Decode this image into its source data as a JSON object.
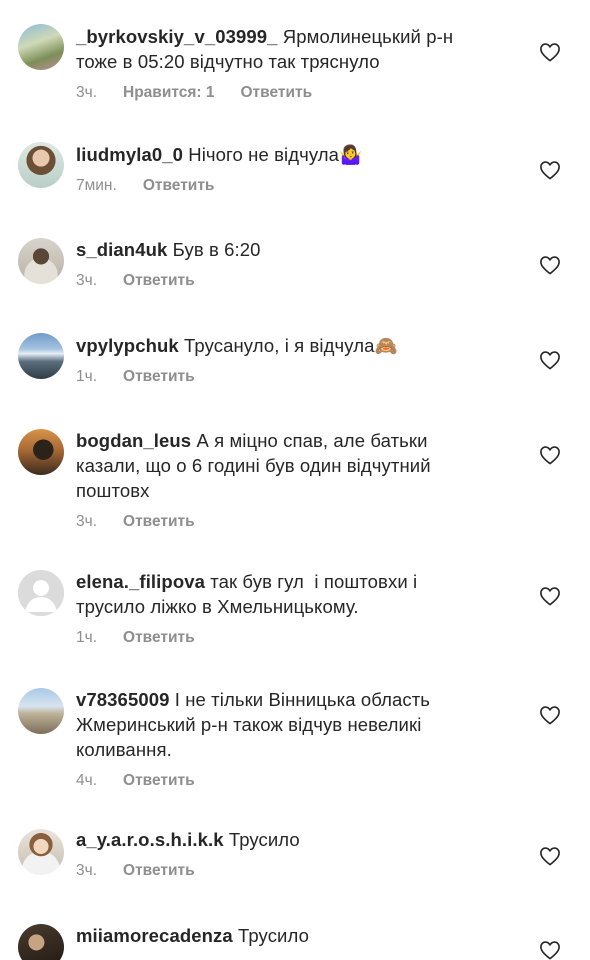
{
  "comments": [
    {
      "avatar": "avatar-photo-outdoor",
      "username": "_byrkovskiy_v_03999_",
      "text_lines": [
        " Ярмолинецький р-н",
        "тоже в 05:20 відчутно так тряснуло"
      ],
      "time": "3ч.",
      "likes": "Нравится: 1",
      "reply": "Ответить"
    },
    {
      "avatar": "avatar-photo-woman",
      "username": "liudmyla0_0",
      "text_lines": [
        " Нічого не відчула🤷‍♀️"
      ],
      "time": "7мин.",
      "likes": "",
      "reply": "Ответить"
    },
    {
      "avatar": "avatar-photo-person",
      "username": "s_dian4uk",
      "text_lines": [
        " Був в 6:20"
      ],
      "time": "3ч.",
      "likes": "",
      "reply": "Ответить"
    },
    {
      "avatar": "avatar-photo-mountains",
      "username": "vpylypchuk",
      "text_lines": [
        " Трусануло, і я відчула🙈"
      ],
      "time": "1ч.",
      "likes": "",
      "reply": "Ответить"
    },
    {
      "avatar": "avatar-photo-sunset",
      "username": "bogdan_leus",
      "text_lines": [
        " А я міцно спав, але батьки",
        "казали, що о 6 годині був один відчутний",
        "поштовх"
      ],
      "time": "3ч.",
      "likes": "",
      "reply": "Ответить"
    },
    {
      "avatar": "avatar-default",
      "username": "elena._filipova",
      "text_lines": [
        " так був гул  і поштовхи і",
        "трусило ліжко в Хмельницькому."
      ],
      "time": "1ч.",
      "likes": "",
      "reply": "Ответить"
    },
    {
      "avatar": "avatar-photo-building",
      "username": "v78365009",
      "text_lines": [
        " І не тільки Вінницька область",
        "Жмеринський р-н також відчув невеликі",
        "коливання."
      ],
      "time": "4ч.",
      "likes": "",
      "reply": "Ответить"
    },
    {
      "avatar": "avatar-photo-portrait",
      "username": "a_y.a.r.o.s.h.i.k.k",
      "text_lines": [
        " Трусило"
      ],
      "time": "3ч.",
      "likes": "",
      "reply": "Ответить"
    },
    {
      "avatar": "avatar-photo-dark",
      "username": "miiamorecadenza",
      "text_lines": [
        " Трусило"
      ],
      "time": "",
      "likes": "",
      "reply": ""
    }
  ]
}
